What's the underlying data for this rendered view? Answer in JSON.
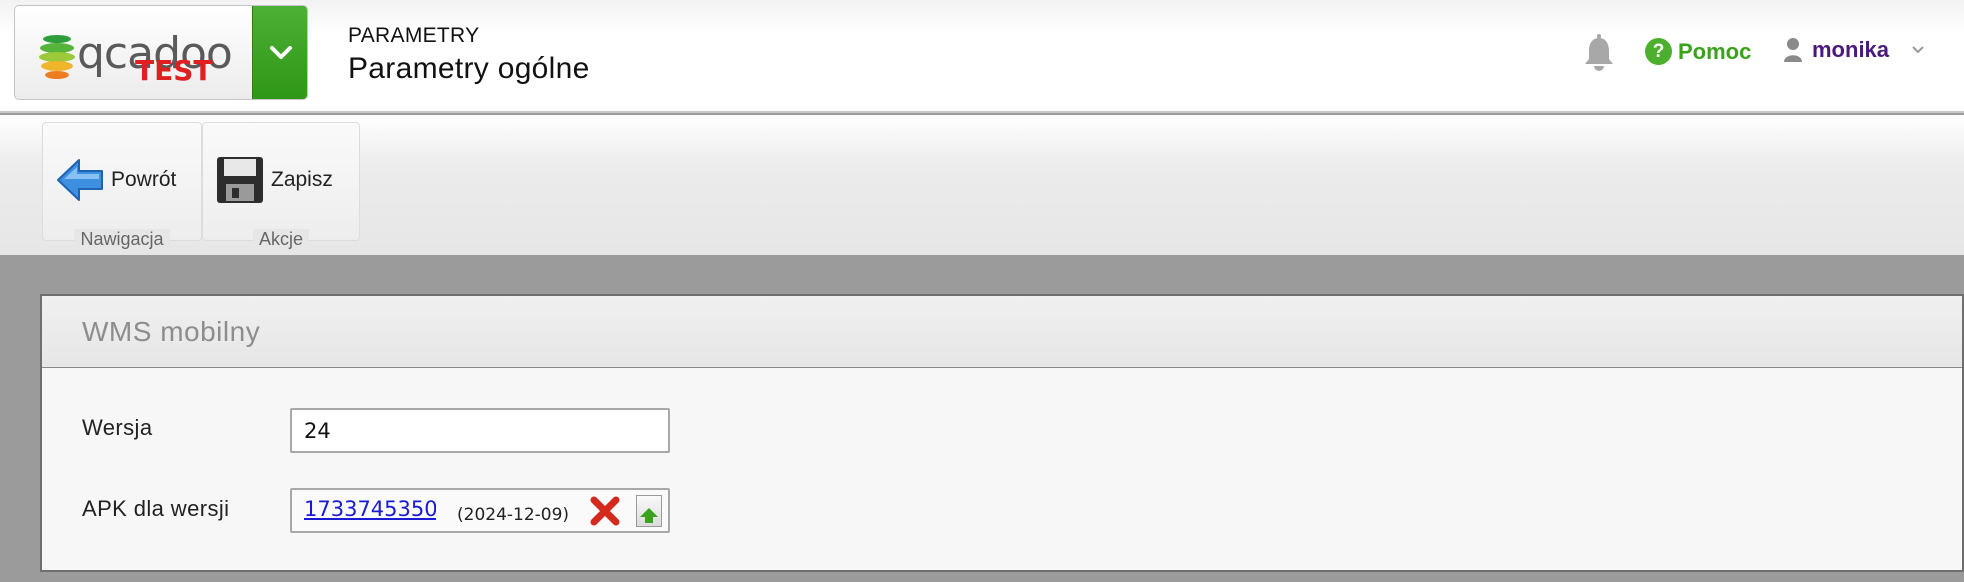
{
  "logo": {
    "brand": "qcadoo",
    "edition": "TEST"
  },
  "header": {
    "section": "PARAMETRY",
    "page_title": "Parametry ogólne",
    "help_label": "Pomoc",
    "help_icon_glyph": "?",
    "user_name": "monika"
  },
  "ribbon": {
    "groups": [
      {
        "caption": "Nawigacja",
        "buttons": [
          {
            "label": "Powrót",
            "icon": "back-arrow-icon"
          }
        ]
      },
      {
        "caption": "Akcje",
        "buttons": [
          {
            "label": "Zapisz",
            "icon": "floppy-disk-icon"
          }
        ]
      }
    ]
  },
  "panel": {
    "title": "WMS mobilny",
    "fields": {
      "version": {
        "label": "Wersja",
        "value": "24"
      },
      "apk": {
        "label": "APK dla wersji",
        "file_name": "1733745350",
        "date": "(2024-12-09)"
      }
    }
  },
  "colors": {
    "accent_green": "#3aa21c",
    "user_purple": "#4a1a7a",
    "link_blue": "#1a1ad4"
  }
}
